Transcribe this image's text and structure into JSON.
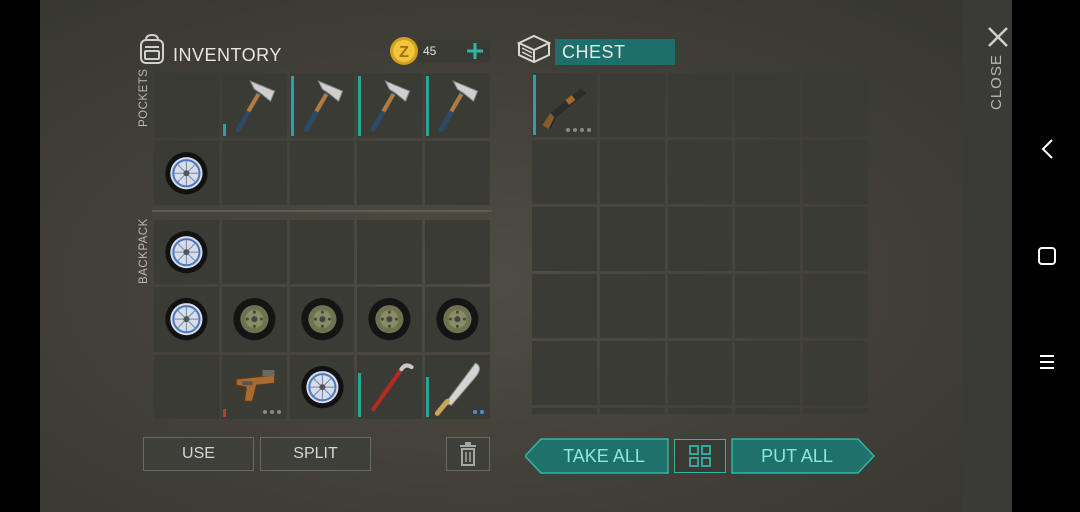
{
  "inventory": {
    "title": "INVENTORY",
    "currency_amount": "45",
    "pockets_label": "POCKETS",
    "backpack_label": "BACKPACK",
    "pockets": [
      {
        "item": "empty"
      },
      {
        "item": "hatchet-icon",
        "durability": 0.2
      },
      {
        "item": "hatchet-icon",
        "durability": 0.95
      },
      {
        "item": "hatchet-icon",
        "durability": 0.95
      },
      {
        "item": "hatchet-icon",
        "durability": 0.95
      },
      {
        "item": "wheel-icon"
      },
      {
        "item": "empty"
      },
      {
        "item": "empty"
      },
      {
        "item": "empty"
      },
      {
        "item": "empty"
      }
    ],
    "backpack": [
      {
        "item": "wheel-icon"
      },
      {
        "item": "empty"
      },
      {
        "item": "empty"
      },
      {
        "item": "empty"
      },
      {
        "item": "empty"
      },
      {
        "item": "wheel-icon"
      },
      {
        "item": "tire-icon"
      },
      {
        "item": "tire-icon"
      },
      {
        "item": "tire-icon"
      },
      {
        "item": "tire-icon"
      },
      {
        "item": "empty"
      },
      {
        "item": "pistol-icon",
        "durability": 0.15
      },
      {
        "item": "wheel-icon"
      },
      {
        "item": "crowbar-icon",
        "durability": 0.7
      },
      {
        "item": "machete-icon",
        "durability": 0.65
      }
    ],
    "use_label": "USE",
    "split_label": "SPLIT"
  },
  "chest": {
    "title": "CHEST",
    "slots": [
      {
        "item": "shotgun-icon",
        "durability": 0.95
      }
    ],
    "take_all_label": "TAKE ALL",
    "put_all_label": "PUT ALL"
  },
  "close_label": "CLOSE",
  "colors": {
    "accent": "#2aa3a0",
    "button_text": "#8ee6dd",
    "slot": "#3b3b35"
  }
}
